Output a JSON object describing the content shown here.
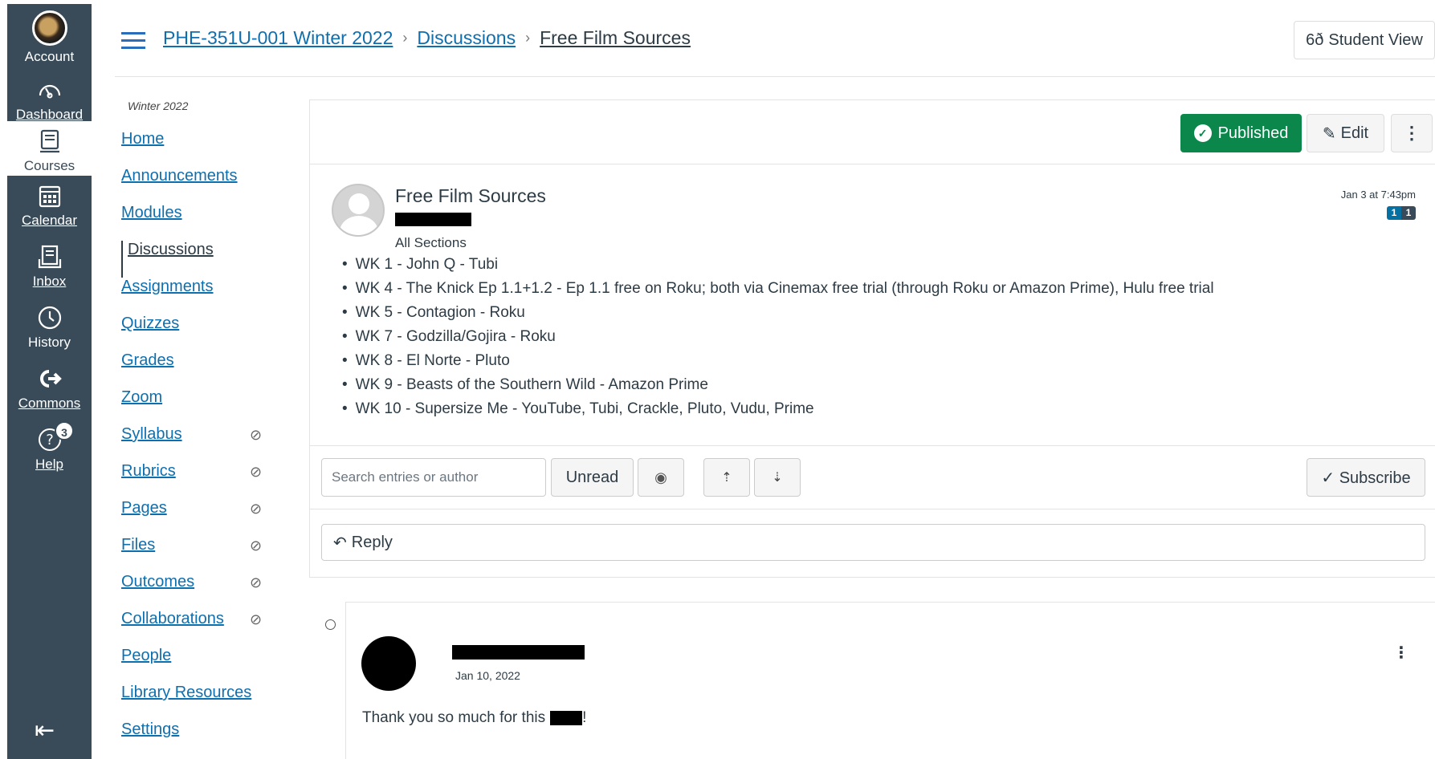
{
  "global_nav": {
    "account": "Account",
    "dashboard": "Dashboard",
    "courses": "Courses",
    "calendar": "Calendar",
    "inbox": "Inbox",
    "history": "History",
    "commons": "Commons",
    "help": "Help",
    "help_badge": "3"
  },
  "header": {
    "breadcrumb": [
      "PHE-351U-001 Winter 2022",
      "Discussions",
      "Free Film Sources"
    ],
    "student_view": "Student View"
  },
  "course_nav": {
    "term": "Winter 2022",
    "items": [
      {
        "label": "Home"
      },
      {
        "label": "Announcements"
      },
      {
        "label": "Modules"
      },
      {
        "label": "Discussions"
      },
      {
        "label": "Assignments"
      },
      {
        "label": "Quizzes"
      },
      {
        "label": "Grades"
      },
      {
        "label": "Zoom"
      },
      {
        "label": "Syllabus"
      },
      {
        "label": "Rubrics"
      },
      {
        "label": "Pages"
      },
      {
        "label": "Files"
      },
      {
        "label": "Outcomes"
      },
      {
        "label": "Collaborations"
      },
      {
        "label": "People"
      },
      {
        "label": "Library Resources"
      },
      {
        "label": "Settings"
      }
    ]
  },
  "toolbar": {
    "published": "Published",
    "edit": "Edit"
  },
  "topic": {
    "title": "Free Film Sources",
    "sections": "All Sections",
    "date": "Jan 3 at 7:43pm",
    "unread_count": "1",
    "total_count": "1",
    "items": [
      "WK 1 - John Q - Tubi",
      "WK 4 - The Knick Ep 1.1+1.2 - Ep 1.1 free on Roku; both via Cinemax free trial (through Roku or Amazon Prime), Hulu free trial",
      "WK 5 - Contagion - Roku",
      "WK 7 - Godzilla/Gojira - Roku",
      "WK 8 - El Norte - Pluto",
      "WK 9 - Beasts of the Southern Wild - Amazon Prime",
      "WK 10 - Supersize Me - YouTube, Tubi, Crackle, Pluto, Vudu, Prime"
    ]
  },
  "controls": {
    "search_placeholder": "Search entries or author",
    "unread": "Unread",
    "subscribe": "Subscribe"
  },
  "reply": {
    "label": "Reply"
  },
  "entry": {
    "date": "Jan 10, 2022",
    "body": "Thank you so much for this",
    "body_end": "!"
  }
}
